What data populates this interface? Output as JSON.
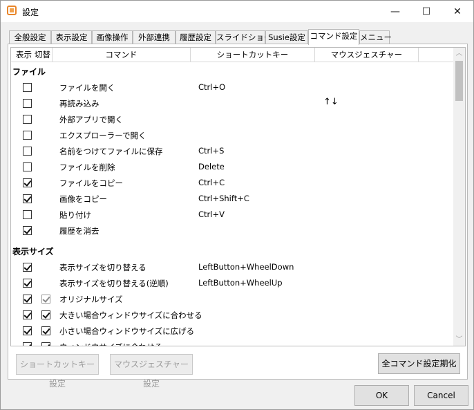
{
  "window": {
    "title": "設定",
    "minimize_glyph": "—",
    "maximize_glyph": "☐",
    "close_glyph": "✕"
  },
  "tabs": [
    {
      "label": "全般設定"
    },
    {
      "label": "表示設定"
    },
    {
      "label": "画像操作"
    },
    {
      "label": "外部連携"
    },
    {
      "label": "履歴設定"
    },
    {
      "label": "スライドショー"
    },
    {
      "label": "Susie設定"
    },
    {
      "label": "コマンド設定"
    },
    {
      "label": "メニュー"
    }
  ],
  "active_tab": "コマンド設定",
  "table": {
    "headers": {
      "show": "表示",
      "toggle": "切替",
      "command": "コマンド",
      "shortcut": "ショートカットキー",
      "gesture": "マウスジェスチャー"
    },
    "groups": [
      {
        "label": "ファイル",
        "rows": [
          {
            "show": false,
            "toggle": null,
            "command": "ファイルを開く",
            "shortcut": "Ctrl+O",
            "gesture": ""
          },
          {
            "show": false,
            "toggle": null,
            "command": "再読み込み",
            "shortcut": "",
            "gesture": "↑↓"
          },
          {
            "show": false,
            "toggle": null,
            "command": "外部アプリで開く",
            "shortcut": "",
            "gesture": ""
          },
          {
            "show": false,
            "toggle": null,
            "command": "エクスプローラーで開く",
            "shortcut": "",
            "gesture": ""
          },
          {
            "show": false,
            "toggle": null,
            "command": "名前をつけてファイルに保存",
            "shortcut": "Ctrl+S",
            "gesture": ""
          },
          {
            "show": false,
            "toggle": null,
            "command": "ファイルを削除",
            "shortcut": "Delete",
            "gesture": ""
          },
          {
            "show": true,
            "toggle": null,
            "command": "ファイルをコピー",
            "shortcut": "Ctrl+C",
            "gesture": ""
          },
          {
            "show": true,
            "toggle": null,
            "command": "画像をコピー",
            "shortcut": "Ctrl+Shift+C",
            "gesture": ""
          },
          {
            "show": false,
            "toggle": null,
            "command": "貼り付け",
            "shortcut": "Ctrl+V",
            "gesture": ""
          },
          {
            "show": true,
            "toggle": null,
            "command": "履歴を消去",
            "shortcut": "",
            "gesture": ""
          }
        ]
      },
      {
        "label": "表示サイズ",
        "rows": [
          {
            "show": true,
            "toggle": null,
            "command": "表示サイズを切り替える",
            "shortcut": "LeftButton+WheelDown",
            "gesture": ""
          },
          {
            "show": true,
            "toggle": null,
            "command": "表示サイズを切り替える(逆順)",
            "shortcut": "LeftButton+WheelUp",
            "gesture": ""
          },
          {
            "show": true,
            "toggle": "dim",
            "command": "オリジナルサイズ",
            "shortcut": "",
            "gesture": ""
          },
          {
            "show": true,
            "toggle": true,
            "command": "大きい場合ウィンドウサイズに合わせる",
            "shortcut": "",
            "gesture": ""
          },
          {
            "show": true,
            "toggle": true,
            "command": "小さい場合ウィンドウサイズに広げる",
            "shortcut": "",
            "gesture": ""
          },
          {
            "show": true,
            "toggle": true,
            "command": "ウィンドウサイズに合わせる",
            "shortcut": "",
            "gesture": ""
          }
        ]
      }
    ]
  },
  "buttons": {
    "shortcut_settings": "ショートカットキー設定",
    "gesture_settings": "マウスジェスチャー設定",
    "init_all": "全コマンド設定期化",
    "ok": "OK",
    "cancel": "Cancel"
  }
}
